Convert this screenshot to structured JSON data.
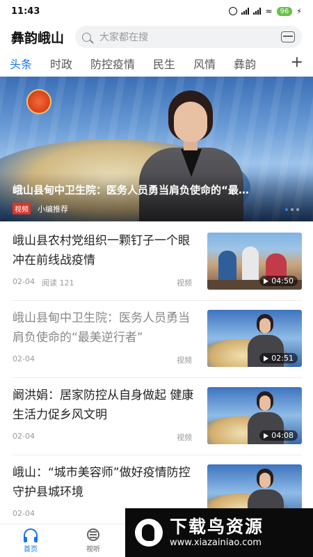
{
  "status": {
    "time": "11:43",
    "battery": "96"
  },
  "header": {
    "brand": "彝韵峨山",
    "search_placeholder": "大家都在搜"
  },
  "tabs": [
    {
      "label": "头条",
      "active": true
    },
    {
      "label": "时政"
    },
    {
      "label": "防控疫情"
    },
    {
      "label": "民生"
    },
    {
      "label": "风情"
    },
    {
      "label": "彝韵"
    }
  ],
  "banner": {
    "title": "峨山县甸中卫生院：医务人员勇当肩负使命的“最…",
    "tag": "视频",
    "source": "小编推荐",
    "slide_count": 3,
    "active_slide": 1
  },
  "news": [
    {
      "title": "峨山县农村党组织一颗钉子一个眼 冲在前线战疫情",
      "date": "02-04",
      "views": "阅读 121",
      "kind": "视频",
      "duration": "04:50",
      "thumb": "field"
    },
    {
      "title": "峨山县甸中卫生院：医务人员勇当肩负使命的“最美逆行者”",
      "date": "02-04",
      "views": "",
      "kind": "视频",
      "duration": "02:51",
      "thumb": "studio"
    },
    {
      "title": "阚洪娟：居家防控从自身做起 健康生活力促乡风文明",
      "date": "02-04",
      "views": "",
      "kind": "视频",
      "duration": "04:08",
      "thumb": "studio"
    },
    {
      "title": "峨山：“城市美容师”做好疫情防控 守护县城环境",
      "date": "02-04",
      "views": "",
      "kind": "",
      "duration": "",
      "thumb": "studio"
    }
  ],
  "bottom_nav": [
    {
      "label": "首页",
      "icon": "headset-icon",
      "active": true
    },
    {
      "label": "视听",
      "icon": "tv-icon"
    }
  ],
  "watermark": {
    "text": "下载鸟资源",
    "url": "www.xiazainiao.com"
  },
  "colors": {
    "accent": "#1a73e8",
    "video_tag": "#d9362b"
  }
}
